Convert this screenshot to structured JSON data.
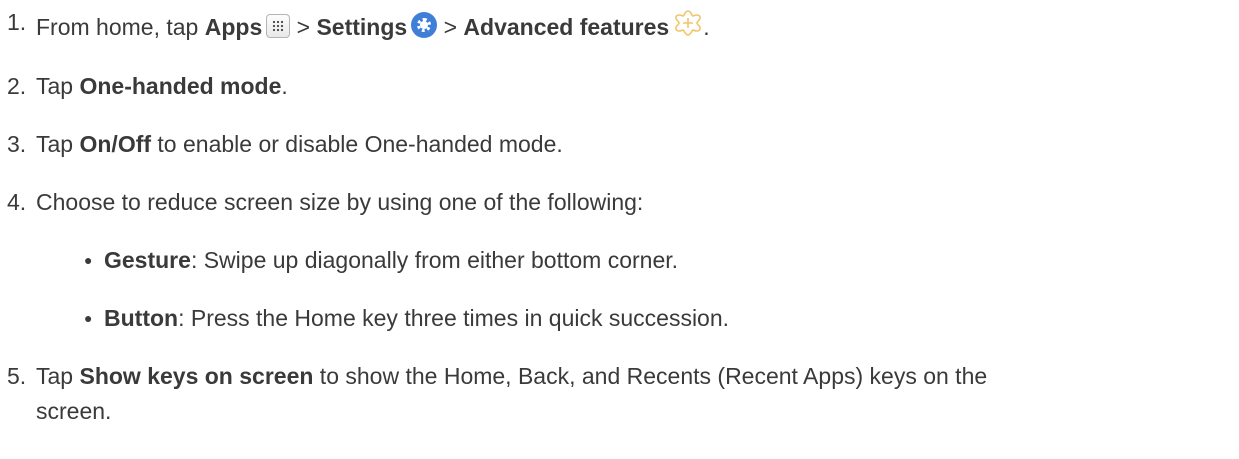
{
  "steps": [
    {
      "num": "1.",
      "prefix": "From home, tap ",
      "apps": "Apps",
      "sep1": " > ",
      "settings": "Settings",
      "sep2": " > ",
      "advanced": "Advanced features",
      "end": "."
    },
    {
      "num": "2.",
      "prefix": "Tap ",
      "bold": "One-handed mode",
      "suffix": "."
    },
    {
      "num": "3.",
      "prefix": "Tap ",
      "bold": "On/Off",
      "suffix": " to enable or disable One-handed mode."
    },
    {
      "num": "4.",
      "text": "Choose to reduce screen size by using one of the following:"
    },
    {
      "num": "5.",
      "prefix": "Tap ",
      "bold": "Show keys on screen",
      "suffix": " to show the Home, Back, and Recents (Recent Apps) keys on the",
      "continuation": "screen."
    }
  ],
  "options": [
    {
      "bullet": "●",
      "bold": "Gesture",
      "text": ": Swipe up diagonally from either bottom corner."
    },
    {
      "bullet": "●",
      "bold": "Button",
      "text": ": Press the Home key three times in quick succession."
    }
  ],
  "icons": {
    "apps": "apps-grid-icon",
    "settings": "settings-gear-icon",
    "advanced": "advanced-features-icon"
  },
  "colors": {
    "text": "#3a3a3a",
    "settings_icon": "#3f7fd8",
    "advanced_icon": "#f2c46c"
  }
}
